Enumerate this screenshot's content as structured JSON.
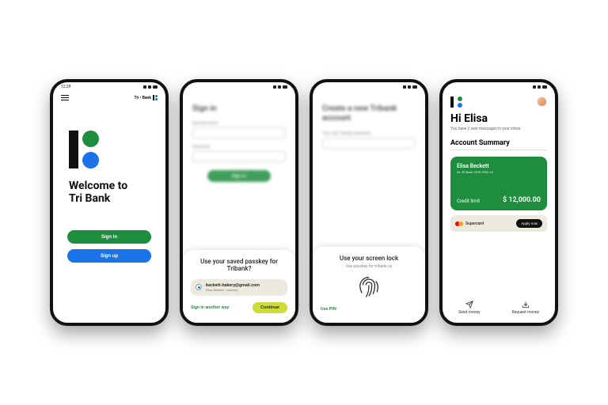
{
  "phone1": {
    "time": "12:29",
    "brand": "Tri • Bank",
    "title": "Welcome to\nTri Bank",
    "signin_btn": "Sign in",
    "signup_btn": "Sign up"
  },
  "phone2": {
    "bg": {
      "heading": "Sign in",
      "label1": "Account name",
      "label2": "Password",
      "cta": "Sign in"
    },
    "sheet": {
      "title": "Use your saved passkey for Tribank?",
      "account_email": "beckett-bakery@gmail.com",
      "account_sub": "Elisa Beckett • passkey",
      "another_way": "Sign in another way",
      "continue": "Continue"
    }
  },
  "phone3": {
    "bg": {
      "heading": "Create a new Tribank account",
      "label1": "Your new Tribank username"
    },
    "sheet": {
      "title": "Use your screen lock",
      "sub": "Use passkey for tribank.us",
      "use_pin": "Use PIN"
    }
  },
  "phone4": {
    "greeting": "Hi Elisa",
    "greeting_sub": "You have 2 new messages in your inbox.",
    "section": "Account Summary",
    "card": {
      "name": "Elisa Beckett",
      "number": "NL 99 Bank 0393 0902 44",
      "limit_label": "Credit limit",
      "amount": "$ 12,000.00"
    },
    "promo": {
      "brand": "Supercard",
      "apply": "Apply now"
    },
    "action_send": "Send money",
    "action_request": "Request money"
  }
}
